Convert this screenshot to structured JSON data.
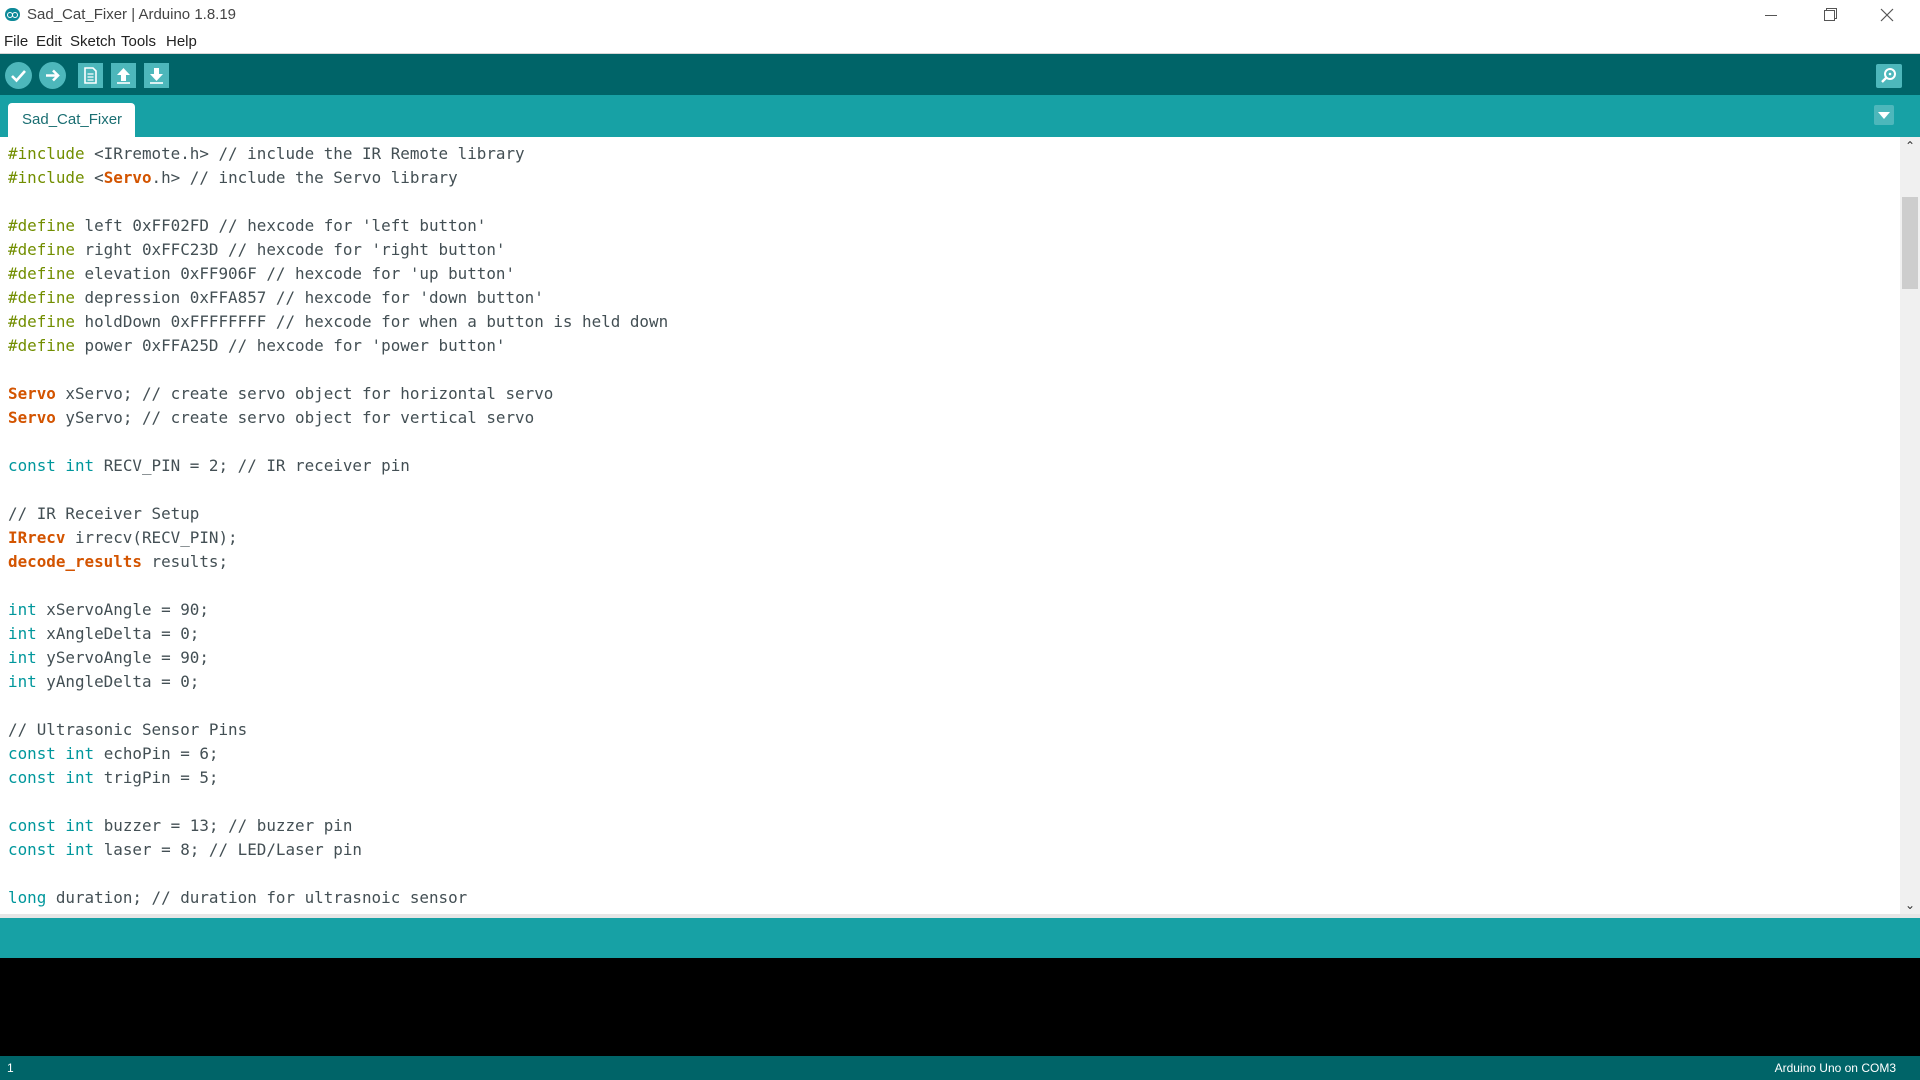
{
  "window": {
    "title": "Sad_Cat_Fixer | Arduino 1.8.19"
  },
  "menu": {
    "items": [
      "File",
      "Edit",
      "Sketch",
      "Tools",
      "Help"
    ]
  },
  "toolbar": {
    "buttons": [
      {
        "name": "verify",
        "icon": "check-icon"
      },
      {
        "name": "upload",
        "icon": "arrow-right-icon"
      },
      {
        "name": "new",
        "icon": "new-file-icon"
      },
      {
        "name": "open",
        "icon": "arrow-up-icon"
      },
      {
        "name": "save",
        "icon": "arrow-down-icon"
      }
    ],
    "serial_monitor_icon": "magnifier-icon"
  },
  "tabs": [
    {
      "label": "Sad_Cat_Fixer",
      "active": true
    }
  ],
  "colors": {
    "toolbar_bg": "#006468",
    "tabbar_bg": "#17a1a5",
    "preprocessor": "#728e00",
    "type_keyword": "#00979c",
    "class_keyword": "#d35400",
    "text": "#434f54"
  },
  "editor": {
    "lines": [
      [
        {
          "t": "#include",
          "c": "kw-pre"
        },
        {
          "t": " <IRremote.h> // include the IR Remote library",
          "c": "txt"
        }
      ],
      [
        {
          "t": "#include",
          "c": "kw-pre"
        },
        {
          "t": " <",
          "c": "txt"
        },
        {
          "t": "Servo",
          "c": "kw-class"
        },
        {
          "t": ".h> // include the Servo library",
          "c": "txt"
        }
      ],
      [],
      [
        {
          "t": "#define",
          "c": "kw-pre"
        },
        {
          "t": " left 0xFF02FD // hexcode for 'left button'",
          "c": "txt"
        }
      ],
      [
        {
          "t": "#define",
          "c": "kw-pre"
        },
        {
          "t": " right 0xFFC23D // hexcode for 'right button'",
          "c": "txt"
        }
      ],
      [
        {
          "t": "#define",
          "c": "kw-pre"
        },
        {
          "t": " elevation 0xFF906F // hexcode for 'up button'",
          "c": "txt"
        }
      ],
      [
        {
          "t": "#define",
          "c": "kw-pre"
        },
        {
          "t": " depression 0xFFA857 // hexcode for 'down button'",
          "c": "txt"
        }
      ],
      [
        {
          "t": "#define",
          "c": "kw-pre"
        },
        {
          "t": " holdDown 0xFFFFFFFF // hexcode for when a button is held down",
          "c": "txt"
        }
      ],
      [
        {
          "t": "#define",
          "c": "kw-pre"
        },
        {
          "t": " power 0xFFA25D // hexcode for 'power button'",
          "c": "txt"
        }
      ],
      [],
      [
        {
          "t": "Servo",
          "c": "kw-class"
        },
        {
          "t": " xServo; // create servo object for horizontal servo",
          "c": "txt"
        }
      ],
      [
        {
          "t": "Servo",
          "c": "kw-class"
        },
        {
          "t": " yServo; // create servo object for vertical servo",
          "c": "txt"
        }
      ],
      [],
      [
        {
          "t": "const",
          "c": "kw-type"
        },
        {
          "t": " ",
          "c": "txt"
        },
        {
          "t": "int",
          "c": "kw-type"
        },
        {
          "t": " RECV_PIN = 2; // IR receiver pin",
          "c": "txt"
        }
      ],
      [],
      [
        {
          "t": "// IR Receiver Setup",
          "c": "cm"
        }
      ],
      [
        {
          "t": "IRrecv",
          "c": "kw-class"
        },
        {
          "t": " irrecv(RECV_PIN);",
          "c": "txt"
        }
      ],
      [
        {
          "t": "decode_results",
          "c": "kw-class"
        },
        {
          "t": " results;",
          "c": "txt"
        }
      ],
      [],
      [
        {
          "t": "int",
          "c": "kw-type"
        },
        {
          "t": " xServoAngle = 90;",
          "c": "txt"
        }
      ],
      [
        {
          "t": "int",
          "c": "kw-type"
        },
        {
          "t": " xAngleDelta = 0;",
          "c": "txt"
        }
      ],
      [
        {
          "t": "int",
          "c": "kw-type"
        },
        {
          "t": " yServoAngle = 90;",
          "c": "txt"
        }
      ],
      [
        {
          "t": "int",
          "c": "kw-type"
        },
        {
          "t": " yAngleDelta = 0;",
          "c": "txt"
        }
      ],
      [],
      [
        {
          "t": "// Ultrasonic Sensor Pins",
          "c": "cm"
        }
      ],
      [
        {
          "t": "const",
          "c": "kw-type"
        },
        {
          "t": " ",
          "c": "txt"
        },
        {
          "t": "int",
          "c": "kw-type"
        },
        {
          "t": " echoPin = 6;",
          "c": "txt"
        }
      ],
      [
        {
          "t": "const",
          "c": "kw-type"
        },
        {
          "t": " ",
          "c": "txt"
        },
        {
          "t": "int",
          "c": "kw-type"
        },
        {
          "t": " trigPin = 5;",
          "c": "txt"
        }
      ],
      [],
      [
        {
          "t": "const",
          "c": "kw-type"
        },
        {
          "t": " ",
          "c": "txt"
        },
        {
          "t": "int",
          "c": "kw-type"
        },
        {
          "t": " buzzer = 13; // buzzer pin",
          "c": "txt"
        }
      ],
      [
        {
          "t": "const",
          "c": "kw-type"
        },
        {
          "t": " ",
          "c": "txt"
        },
        {
          "t": "int",
          "c": "kw-type"
        },
        {
          "t": " laser = 8; // LED/Laser pin",
          "c": "txt"
        }
      ],
      [],
      [
        {
          "t": "long",
          "c": "kw-type"
        },
        {
          "t": " duration; // duration for ultrasnoic sensor",
          "c": "txt"
        }
      ]
    ]
  },
  "status": {
    "line_number": "1",
    "board": "Arduino Uno on COM3"
  }
}
